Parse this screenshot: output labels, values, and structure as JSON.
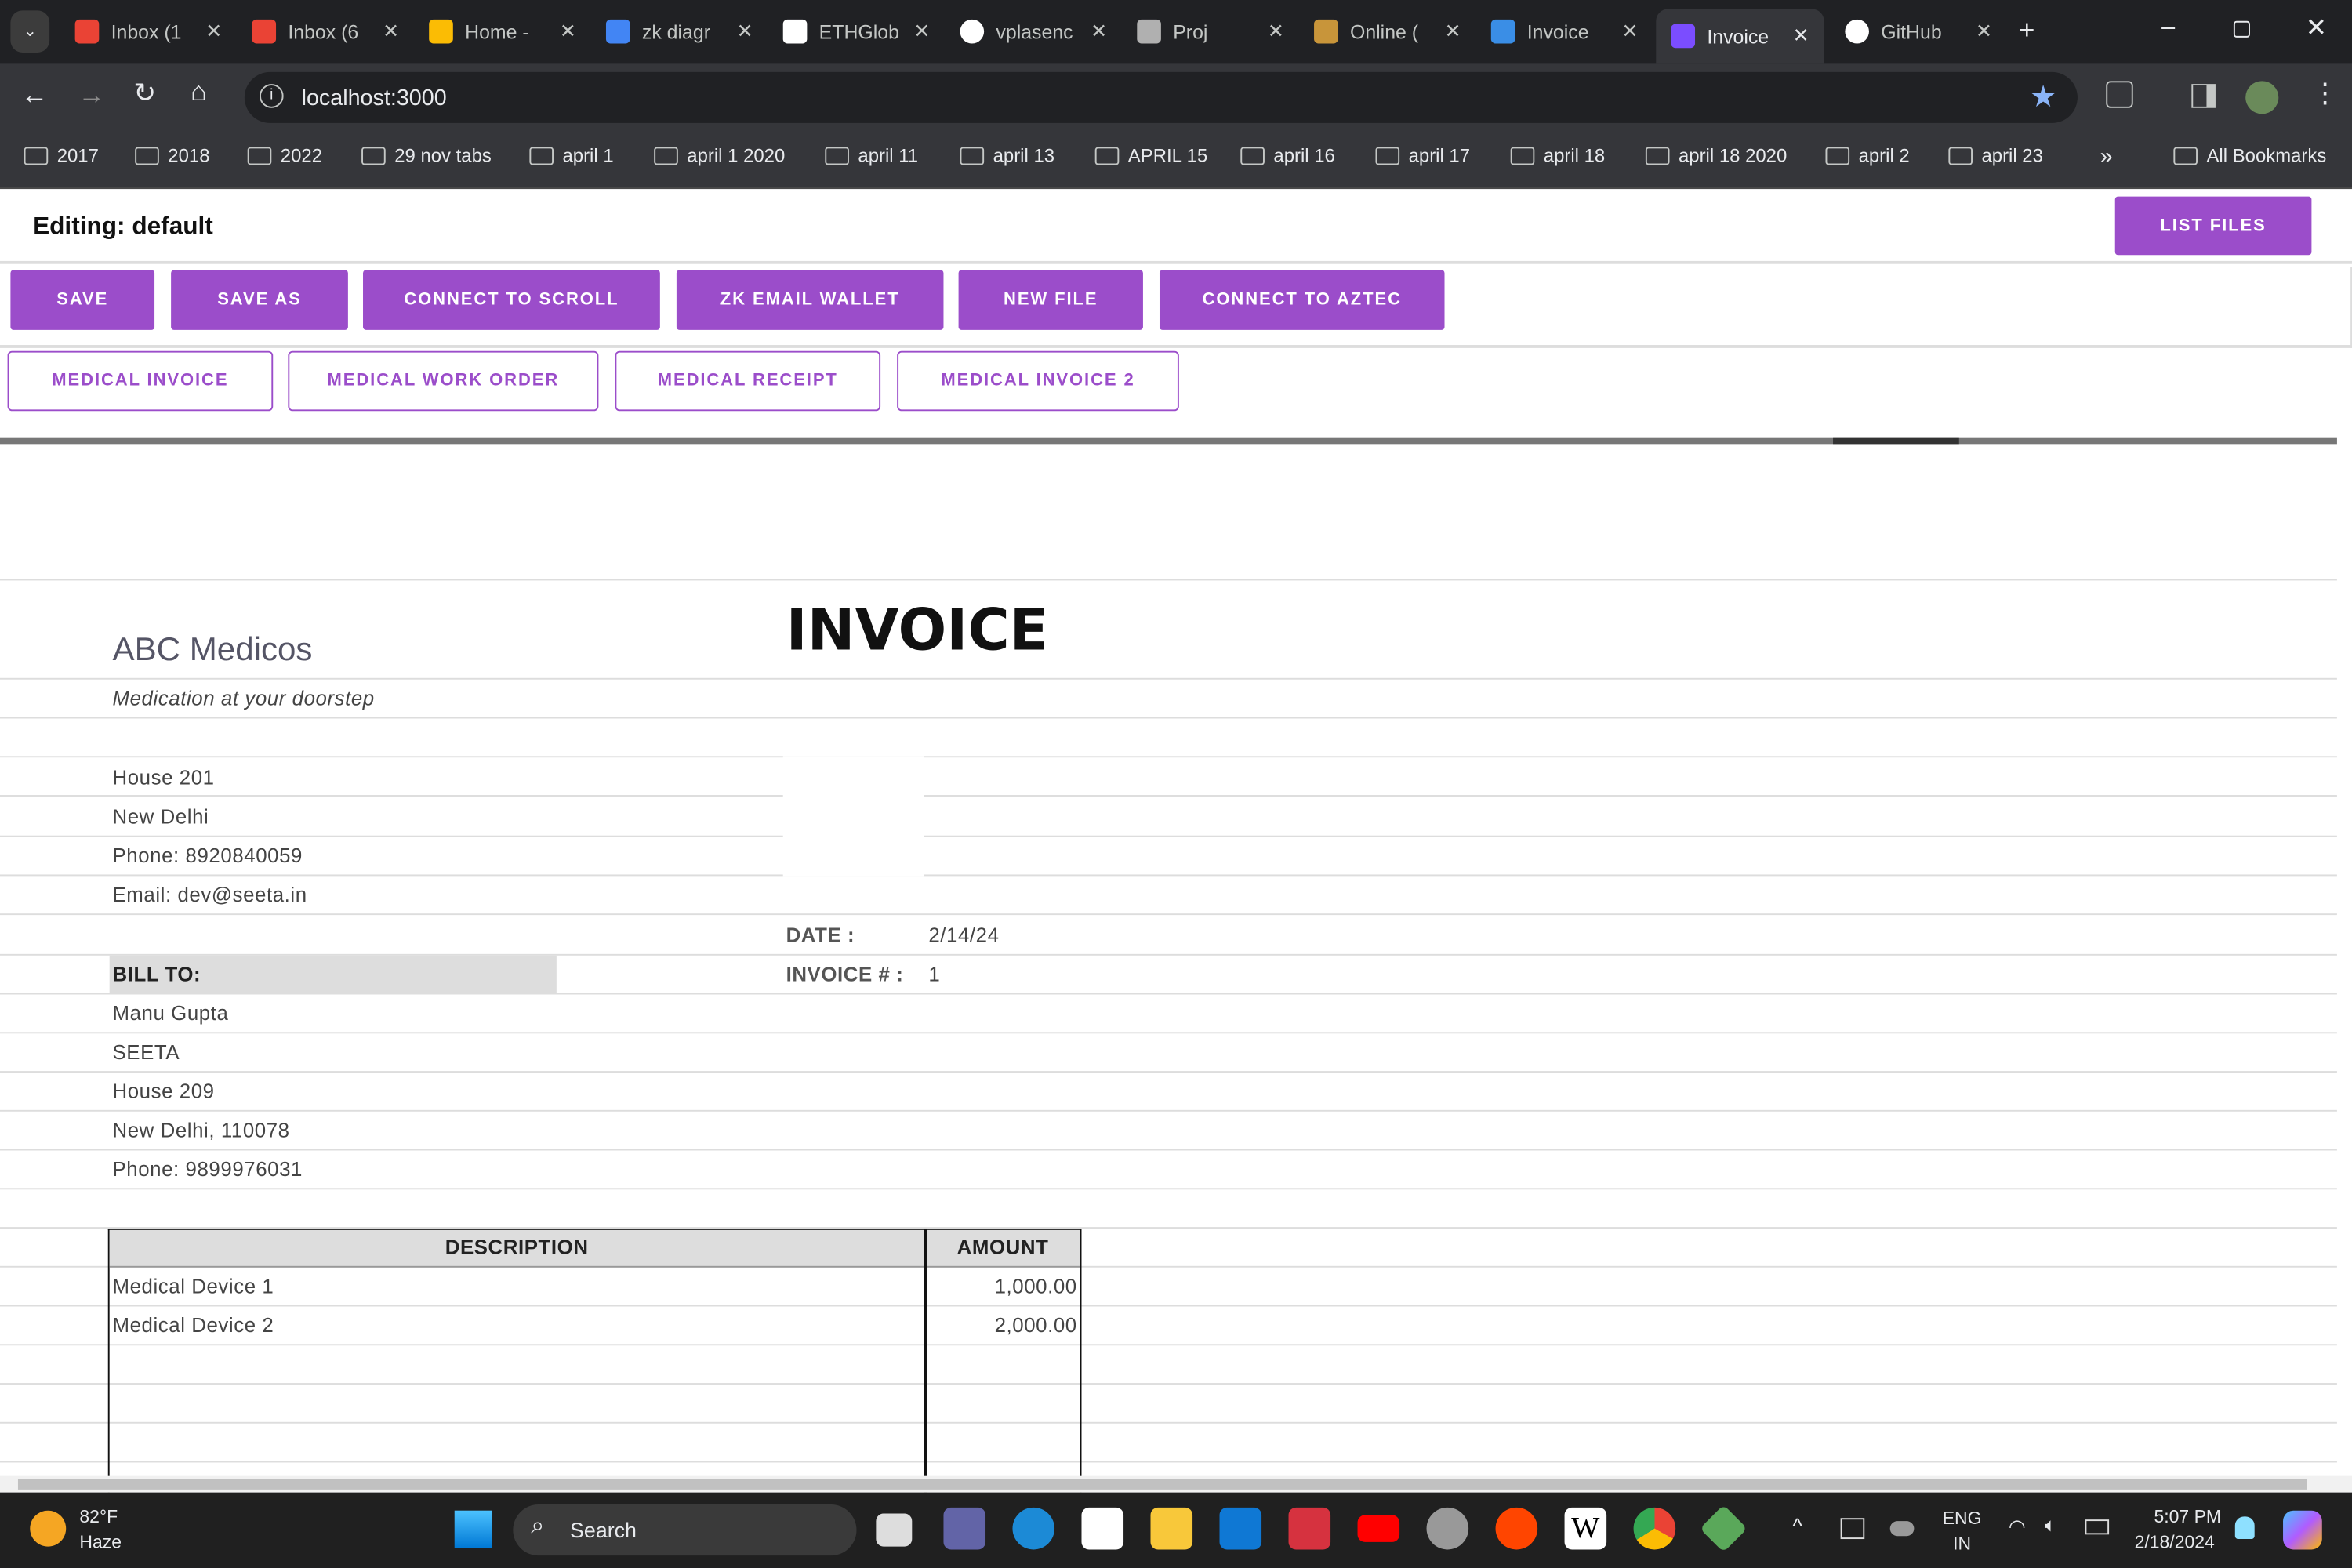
{
  "browser": {
    "tabs": [
      {
        "title": "Inbox (1",
        "icon": "gmail-icon",
        "color": "#ea4335"
      },
      {
        "title": "Inbox (6",
        "icon": "gmail-icon",
        "color": "#ea4335"
      },
      {
        "title": "Home -",
        "icon": "drive-icon",
        "color": "#fbbc04"
      },
      {
        "title": "zk diagr",
        "icon": "docs-icon",
        "color": "#4285f4"
      },
      {
        "title": "ETHGlob",
        "icon": "ethglobal-icon",
        "color": "#ffffff"
      },
      {
        "title": "vplasenc",
        "icon": "github-icon",
        "color": "#ffffff"
      },
      {
        "title": "Proj",
        "icon": "tools-icon",
        "color": "#b0b0b0"
      },
      {
        "title": "Online (",
        "icon": "box-icon",
        "color": "#c8953a"
      },
      {
        "title": "Invoice",
        "icon": "invoice-icon",
        "color": "#3a8ee6"
      },
      {
        "title": "Invoice",
        "icon": "invoice-icon",
        "color": "#7b4dff",
        "active": true
      },
      {
        "title": "GitHub",
        "icon": "github-icon",
        "color": "#ffffff"
      }
    ],
    "url": "localhost:3000",
    "bookmarks": [
      "2017",
      "2018",
      "2022",
      "29 nov tabs",
      "april 1",
      "april 1 2020",
      "april 11",
      "april 13",
      "APRIL 15",
      "april 16",
      "april 17",
      "april 18",
      "april 18 2020",
      "april 2",
      "april 23"
    ],
    "all_bookmarks": "All Bookmarks"
  },
  "app": {
    "editing": "Editing: default",
    "list_files": "LIST FILES",
    "actions": [
      "SAVE",
      "SAVE AS",
      "CONNECT TO SCROLL",
      "ZK EMAIL WALLET",
      "NEW FILE",
      "CONNECT TO AZTEC"
    ],
    "templates": [
      "MEDICAL INVOICE",
      "MEDICAL WORK ORDER",
      "MEDICAL RECEIPT",
      "MEDICAL INVOICE 2"
    ],
    "accent": "#9b4dca"
  },
  "invoice": {
    "company": "ABC Medicos",
    "tagline": "Medication at your doorstep",
    "title": "INVOICE",
    "address": [
      "House 201",
      "New Delhi",
      "Phone: 8920840059",
      "Email: dev@seeta.in"
    ],
    "date_label": "DATE :",
    "date": "2/14/24",
    "number_label": "INVOICE # :",
    "number": "1",
    "bill_to_label": "BILL TO:",
    "bill_to": [
      "Manu Gupta",
      "SEETA",
      "House 209",
      "New Delhi, 110078",
      "Phone: 9899976031"
    ],
    "columns": [
      "DESCRIPTION",
      "AMOUNT"
    ],
    "items": [
      {
        "description": "Medical Device 1",
        "amount": "1,000.00"
      },
      {
        "description": "Medical Device 2",
        "amount": "2,000.00"
      }
    ]
  },
  "taskbar": {
    "weather_temp": "82°F",
    "weather_desc": "Haze",
    "search": "Search",
    "lang": "ENG",
    "region": "IN",
    "time": "5:07 PM",
    "date": "2/18/2024"
  }
}
